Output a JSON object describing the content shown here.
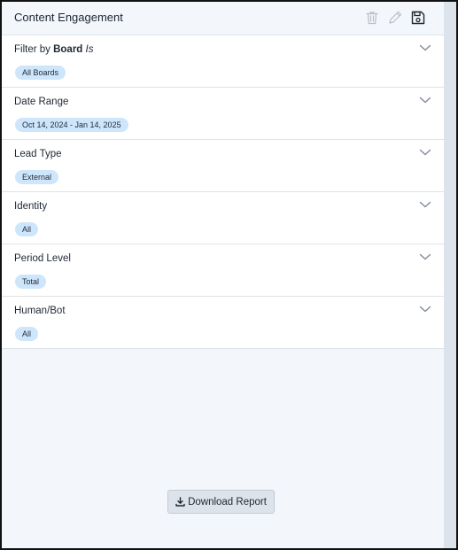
{
  "header": {
    "title": "Content Engagement",
    "actions": [
      {
        "name": "delete-button",
        "icon": "trash-icon"
      },
      {
        "name": "edit-button",
        "icon": "pencil-icon"
      },
      {
        "name": "save-button",
        "icon": "save-icon"
      }
    ]
  },
  "filters": [
    {
      "label_prefix": "Filter by ",
      "label_bold": "Board",
      "label_italic": " Is",
      "value": "All Boards"
    },
    {
      "label": "Date Range",
      "value": "Oct 14, 2024 - Jan 14, 2025"
    },
    {
      "label": "Lead Type",
      "value": "External"
    },
    {
      "label": "Identity",
      "value": "All"
    },
    {
      "label": "Period Level",
      "value": "Total"
    },
    {
      "label": "Human/Bot",
      "value": "All"
    }
  ],
  "footer": {
    "download_label": "Download Report",
    "download_icon": "download-icon"
  },
  "colors": {
    "panel_bg": "#f3f6fa",
    "chip_bg": "#cde6fb",
    "text": "#1f2733"
  }
}
